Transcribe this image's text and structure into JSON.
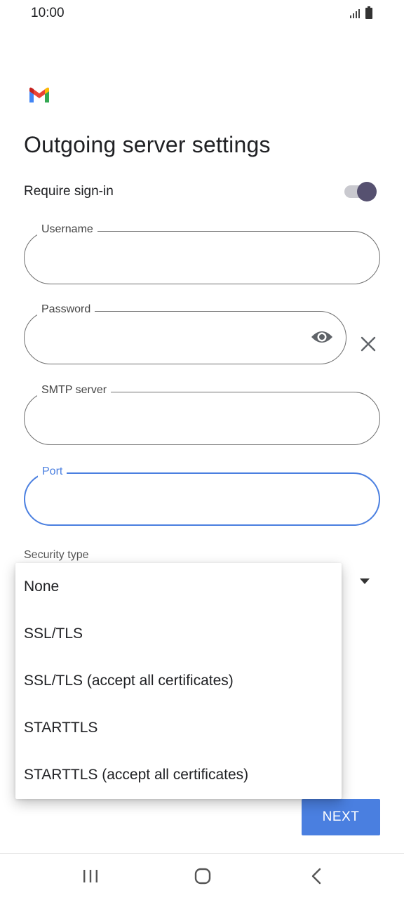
{
  "status_bar": {
    "time": "10:00",
    "icons": [
      "signal-icon",
      "battery-icon"
    ]
  },
  "app": {
    "logo": "gmail-logo",
    "title": "Outgoing server settings"
  },
  "require_signin": {
    "label": "Require sign-in",
    "enabled": true
  },
  "fields": {
    "username": {
      "label": "Username",
      "value": ""
    },
    "password": {
      "label": "Password",
      "value": ""
    },
    "smtp_server": {
      "label": "SMTP server",
      "value": ""
    },
    "port": {
      "label": "Port",
      "value": ""
    }
  },
  "security": {
    "label": "Security type",
    "options": [
      "None",
      "SSL/TLS",
      "SSL/TLS (accept all certificates)",
      "STARTTLS",
      "STARTTLS (accept all certificates)"
    ]
  },
  "next_button": {
    "label": "NEXT"
  },
  "colors": {
    "accent": "#4a7fe0",
    "toggle_thumb": "#565170",
    "toggle_track": "#c9c9cf"
  },
  "nav_icons": [
    "recent-apps-icon",
    "home-icon",
    "back-icon"
  ]
}
